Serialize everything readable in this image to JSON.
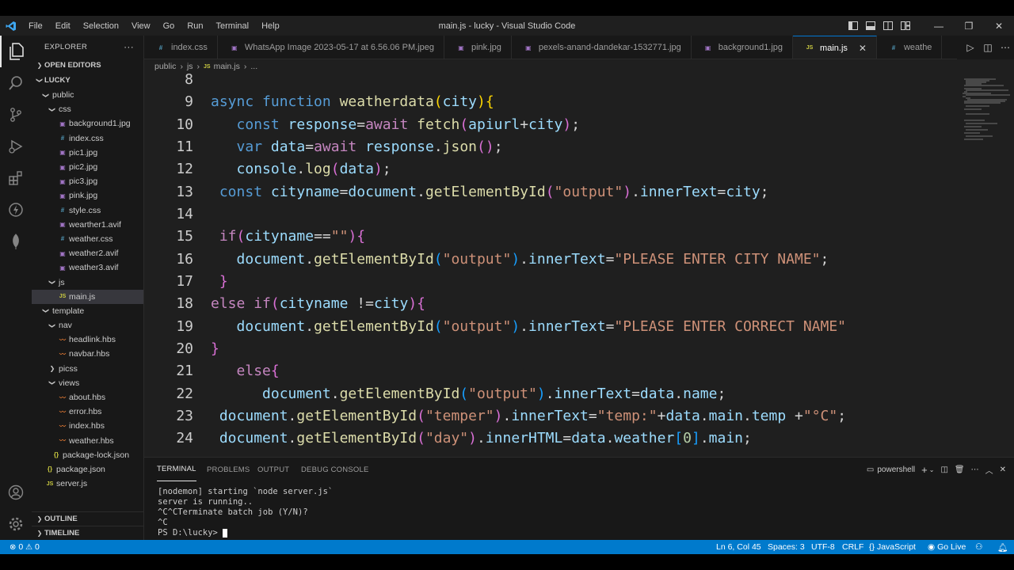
{
  "window": {
    "title": "main.js - lucky - Visual Studio Code",
    "menu": [
      "File",
      "Edit",
      "Selection",
      "View",
      "Go",
      "Run",
      "Terminal",
      "Help"
    ],
    "controls": {
      "minimize": "—",
      "restore": "❐",
      "close": "✕"
    }
  },
  "activity_bar": [
    "files-icon",
    "search-icon",
    "source-control-icon",
    "run-debug-icon",
    "extensions-icon",
    "remote-icon",
    "mongodb-leaf-icon",
    "account-icon",
    "settings-gear-icon"
  ],
  "sidebar": {
    "title": "EXPLORER",
    "more": "···",
    "open_editors": "OPEN EDITORS",
    "root": "LUCKY",
    "tree": [
      {
        "label": "public",
        "type": "folder",
        "depth": 1,
        "open": true
      },
      {
        "label": "css",
        "type": "folder",
        "depth": 2,
        "open": true
      },
      {
        "label": "background1.jpg",
        "type": "img",
        "depth": 3
      },
      {
        "label": "index.css",
        "type": "css",
        "depth": 3
      },
      {
        "label": "pic1.jpg",
        "type": "img",
        "depth": 3
      },
      {
        "label": "pic2.jpg",
        "type": "img",
        "depth": 3
      },
      {
        "label": "pic3.jpg",
        "type": "img",
        "depth": 3
      },
      {
        "label": "pink.jpg",
        "type": "img",
        "depth": 3
      },
      {
        "label": "style.css",
        "type": "css",
        "depth": 3
      },
      {
        "label": "wearther1.avif",
        "type": "img",
        "depth": 3
      },
      {
        "label": "weather.css",
        "type": "css",
        "depth": 3
      },
      {
        "label": "weather2.avif",
        "type": "img",
        "depth": 3
      },
      {
        "label": "weather3.avif",
        "type": "img",
        "depth": 3
      },
      {
        "label": "js",
        "type": "folder",
        "depth": 2,
        "open": true
      },
      {
        "label": "main.js",
        "type": "js",
        "depth": 3,
        "selected": true
      },
      {
        "label": "template",
        "type": "folder",
        "depth": 1,
        "open": true
      },
      {
        "label": "nav",
        "type": "folder",
        "depth": 2,
        "open": true
      },
      {
        "label": "headlink.hbs",
        "type": "hbs",
        "depth": 3
      },
      {
        "label": "navbar.hbs",
        "type": "hbs",
        "depth": 3
      },
      {
        "label": "picss",
        "type": "folder",
        "depth": 2,
        "open": false
      },
      {
        "label": "views",
        "type": "folder",
        "depth": 2,
        "open": true
      },
      {
        "label": "about.hbs",
        "type": "hbs",
        "depth": 3
      },
      {
        "label": "error.hbs",
        "type": "hbs",
        "depth": 3
      },
      {
        "label": "index.hbs",
        "type": "hbs",
        "depth": 3
      },
      {
        "label": "weather.hbs",
        "type": "hbs",
        "depth": 3
      },
      {
        "label": "package-lock.json",
        "type": "json",
        "depth": 2
      },
      {
        "label": "package.json",
        "type": "json",
        "depth": 1
      },
      {
        "label": "server.js",
        "type": "js",
        "depth": 1
      }
    ],
    "outline": "OUTLINE",
    "timeline": "TIMELINE"
  },
  "tabs": [
    {
      "label": "index.css",
      "icon": "#",
      "type": "css"
    },
    {
      "label": "WhatsApp Image 2023-05-17 at 6.56.06 PM.jpeg",
      "icon": "▣",
      "type": "img"
    },
    {
      "label": "pink.jpg",
      "icon": "▣",
      "type": "img"
    },
    {
      "label": "pexels-anand-dandekar-1532771.jpg",
      "icon": "▣",
      "type": "img"
    },
    {
      "label": "background1.jpg",
      "icon": "▣",
      "type": "img"
    },
    {
      "label": "main.js",
      "icon": "JS",
      "type": "js",
      "active": true,
      "close": "✕"
    },
    {
      "label": "weathe",
      "icon": "#",
      "type": "css"
    }
  ],
  "breadcrumb": [
    "public",
    "js",
    "main.js",
    "..."
  ],
  "code_lines": [
    {
      "n": "8",
      "tokens": []
    },
    {
      "n": "9",
      "tokens": [
        [
          "kw",
          "async "
        ],
        [
          "kw",
          "function "
        ],
        [
          "fn",
          "weatherdata"
        ],
        [
          "b1",
          "("
        ],
        [
          "vr",
          "city"
        ],
        [
          "b1",
          "){"
        ]
      ]
    },
    {
      "n": "10",
      "tokens": [
        [
          "tx",
          "   "
        ],
        [
          "kw",
          "const "
        ],
        [
          "vr",
          "response"
        ],
        [
          "tx",
          "="
        ],
        [
          "ctl",
          "await "
        ],
        [
          "fn",
          "fetch"
        ],
        [
          "b2",
          "("
        ],
        [
          "vr",
          "apiurl"
        ],
        [
          "tx",
          "+"
        ],
        [
          "vr",
          "city"
        ],
        [
          "b2",
          ")"
        ],
        [
          "tx",
          ";"
        ]
      ]
    },
    {
      "n": "11",
      "tokens": [
        [
          "tx",
          "   "
        ],
        [
          "kw",
          "var "
        ],
        [
          "vr",
          "data"
        ],
        [
          "tx",
          "="
        ],
        [
          "ctl",
          "await "
        ],
        [
          "vr",
          "response"
        ],
        [
          "tx",
          "."
        ],
        [
          "fn",
          "json"
        ],
        [
          "b2",
          "()"
        ],
        [
          "tx",
          ";"
        ]
      ]
    },
    {
      "n": "12",
      "tokens": [
        [
          "tx",
          "   "
        ],
        [
          "vr",
          "console"
        ],
        [
          "tx",
          "."
        ],
        [
          "fn",
          "log"
        ],
        [
          "b2",
          "("
        ],
        [
          "vr",
          "data"
        ],
        [
          "b2",
          ")"
        ],
        [
          "tx",
          ";"
        ]
      ]
    },
    {
      "n": "13",
      "tokens": [
        [
          "tx",
          " "
        ],
        [
          "kw",
          "const "
        ],
        [
          "vr",
          "cityname"
        ],
        [
          "tx",
          "="
        ],
        [
          "vr",
          "document"
        ],
        [
          "tx",
          "."
        ],
        [
          "fn",
          "getElementById"
        ],
        [
          "b2",
          "("
        ],
        [
          "str",
          "\"output\""
        ],
        [
          "b2",
          ")"
        ],
        [
          "tx",
          "."
        ],
        [
          "vr",
          "innerText"
        ],
        [
          "tx",
          "="
        ],
        [
          "vr",
          "city"
        ],
        [
          "tx",
          ";"
        ]
      ]
    },
    {
      "n": "14",
      "tokens": []
    },
    {
      "n": "15",
      "tokens": [
        [
          "tx",
          " "
        ],
        [
          "ctl",
          "if"
        ],
        [
          "b2",
          "("
        ],
        [
          "vr",
          "cityname"
        ],
        [
          "tx",
          "=="
        ],
        [
          "str",
          "\"\""
        ],
        [
          "b2",
          "){"
        ]
      ]
    },
    {
      "n": "16",
      "tokens": [
        [
          "tx",
          "   "
        ],
        [
          "vr",
          "document"
        ],
        [
          "tx",
          "."
        ],
        [
          "fn",
          "getElementById"
        ],
        [
          "b3",
          "("
        ],
        [
          "str",
          "\"output\""
        ],
        [
          "b3",
          ")"
        ],
        [
          "tx",
          "."
        ],
        [
          "vr",
          "innerText"
        ],
        [
          "tx",
          "="
        ],
        [
          "str",
          "\"PLEASE ENTER CITY NAME\""
        ],
        [
          "tx",
          ";"
        ]
      ]
    },
    {
      "n": "17",
      "tokens": [
        [
          "tx",
          " "
        ],
        [
          "b2",
          "}"
        ]
      ]
    },
    {
      "n": "18",
      "tokens": [
        [
          "ctl",
          "else "
        ],
        [
          "ctl",
          "if"
        ],
        [
          "b2",
          "("
        ],
        [
          "vr",
          "cityname "
        ],
        [
          "tx",
          "!="
        ],
        [
          "vr",
          "city"
        ],
        [
          "b2",
          "){"
        ]
      ]
    },
    {
      "n": "19",
      "tokens": [
        [
          "tx",
          "   "
        ],
        [
          "vr",
          "document"
        ],
        [
          "tx",
          "."
        ],
        [
          "fn",
          "getElementById"
        ],
        [
          "b3",
          "("
        ],
        [
          "str",
          "\"output\""
        ],
        [
          "b3",
          ")"
        ],
        [
          "tx",
          "."
        ],
        [
          "vr",
          "innerText"
        ],
        [
          "tx",
          "="
        ],
        [
          "str",
          "\"PLEASE ENTER CORRECT NAME\""
        ]
      ]
    },
    {
      "n": "20",
      "tokens": [
        [
          "b2",
          "}"
        ]
      ]
    },
    {
      "n": "21",
      "tokens": [
        [
          "tx",
          "   "
        ],
        [
          "ctl",
          "else"
        ],
        [
          "b2",
          "{"
        ]
      ]
    },
    {
      "n": "22",
      "tokens": [
        [
          "tx",
          "      "
        ],
        [
          "vr",
          "document"
        ],
        [
          "tx",
          "."
        ],
        [
          "fn",
          "getElementById"
        ],
        [
          "b3",
          "("
        ],
        [
          "str",
          "\"output\""
        ],
        [
          "b3",
          ")"
        ],
        [
          "tx",
          "."
        ],
        [
          "vr",
          "innerText"
        ],
        [
          "tx",
          "="
        ],
        [
          "vr",
          "data"
        ],
        [
          "tx",
          "."
        ],
        [
          "vr",
          "name"
        ],
        [
          "tx",
          ";"
        ]
      ]
    },
    {
      "n": "23",
      "tokens": [
        [
          "tx",
          " "
        ],
        [
          "vr",
          "document"
        ],
        [
          "tx",
          "."
        ],
        [
          "fn",
          "getElementById"
        ],
        [
          "b2",
          "("
        ],
        [
          "str",
          "\"temper\""
        ],
        [
          "b2",
          ")"
        ],
        [
          "tx",
          "."
        ],
        [
          "vr",
          "innerText"
        ],
        [
          "tx",
          "="
        ],
        [
          "str",
          "\"temp:\""
        ],
        [
          "tx",
          "+"
        ],
        [
          "vr",
          "data"
        ],
        [
          "tx",
          "."
        ],
        [
          "vr",
          "main"
        ],
        [
          "tx",
          "."
        ],
        [
          "vr",
          "temp "
        ],
        [
          "tx",
          "+"
        ],
        [
          "str",
          "\"°C\""
        ],
        [
          "tx",
          ";"
        ]
      ]
    },
    {
      "n": "24",
      "tokens": [
        [
          "tx",
          " "
        ],
        [
          "vr",
          "document"
        ],
        [
          "tx",
          "."
        ],
        [
          "fn",
          "getElementById"
        ],
        [
          "b2",
          "("
        ],
        [
          "str",
          "\"day\""
        ],
        [
          "b2",
          ")"
        ],
        [
          "tx",
          "."
        ],
        [
          "vr",
          "innerHTML"
        ],
        [
          "tx",
          "="
        ],
        [
          "vr",
          "data"
        ],
        [
          "tx",
          "."
        ],
        [
          "vr",
          "weather"
        ],
        [
          "b3",
          "["
        ],
        [
          "num",
          "0"
        ],
        [
          "b3",
          "]"
        ],
        [
          "tx",
          "."
        ],
        [
          "vr",
          "main"
        ],
        [
          "tx",
          ";"
        ]
      ]
    }
  ],
  "panel": {
    "tabs": [
      "TERMINAL",
      "PROBLEMS",
      "OUTPUT",
      "DEBUG CONSOLE"
    ],
    "shell": "powershell",
    "terminal_lines": [
      "[nodemon] starting `node server.js`",
      "server is running..",
      "^C^CTerminate batch job (Y/N)?",
      "^C",
      "PS D:\\lucky> "
    ]
  },
  "status": {
    "errors": "0",
    "warnings": "0",
    "position": "Ln 6, Col 45",
    "spaces": "Spaces: 3",
    "encoding": "UTF-8",
    "eol": "CRLF",
    "language": "JavaScript",
    "go_live": "Go Live"
  },
  "colors": {
    "accent": "#007acc",
    "editor_bg": "#1f1f1f",
    "sidebar_bg": "#181818"
  }
}
